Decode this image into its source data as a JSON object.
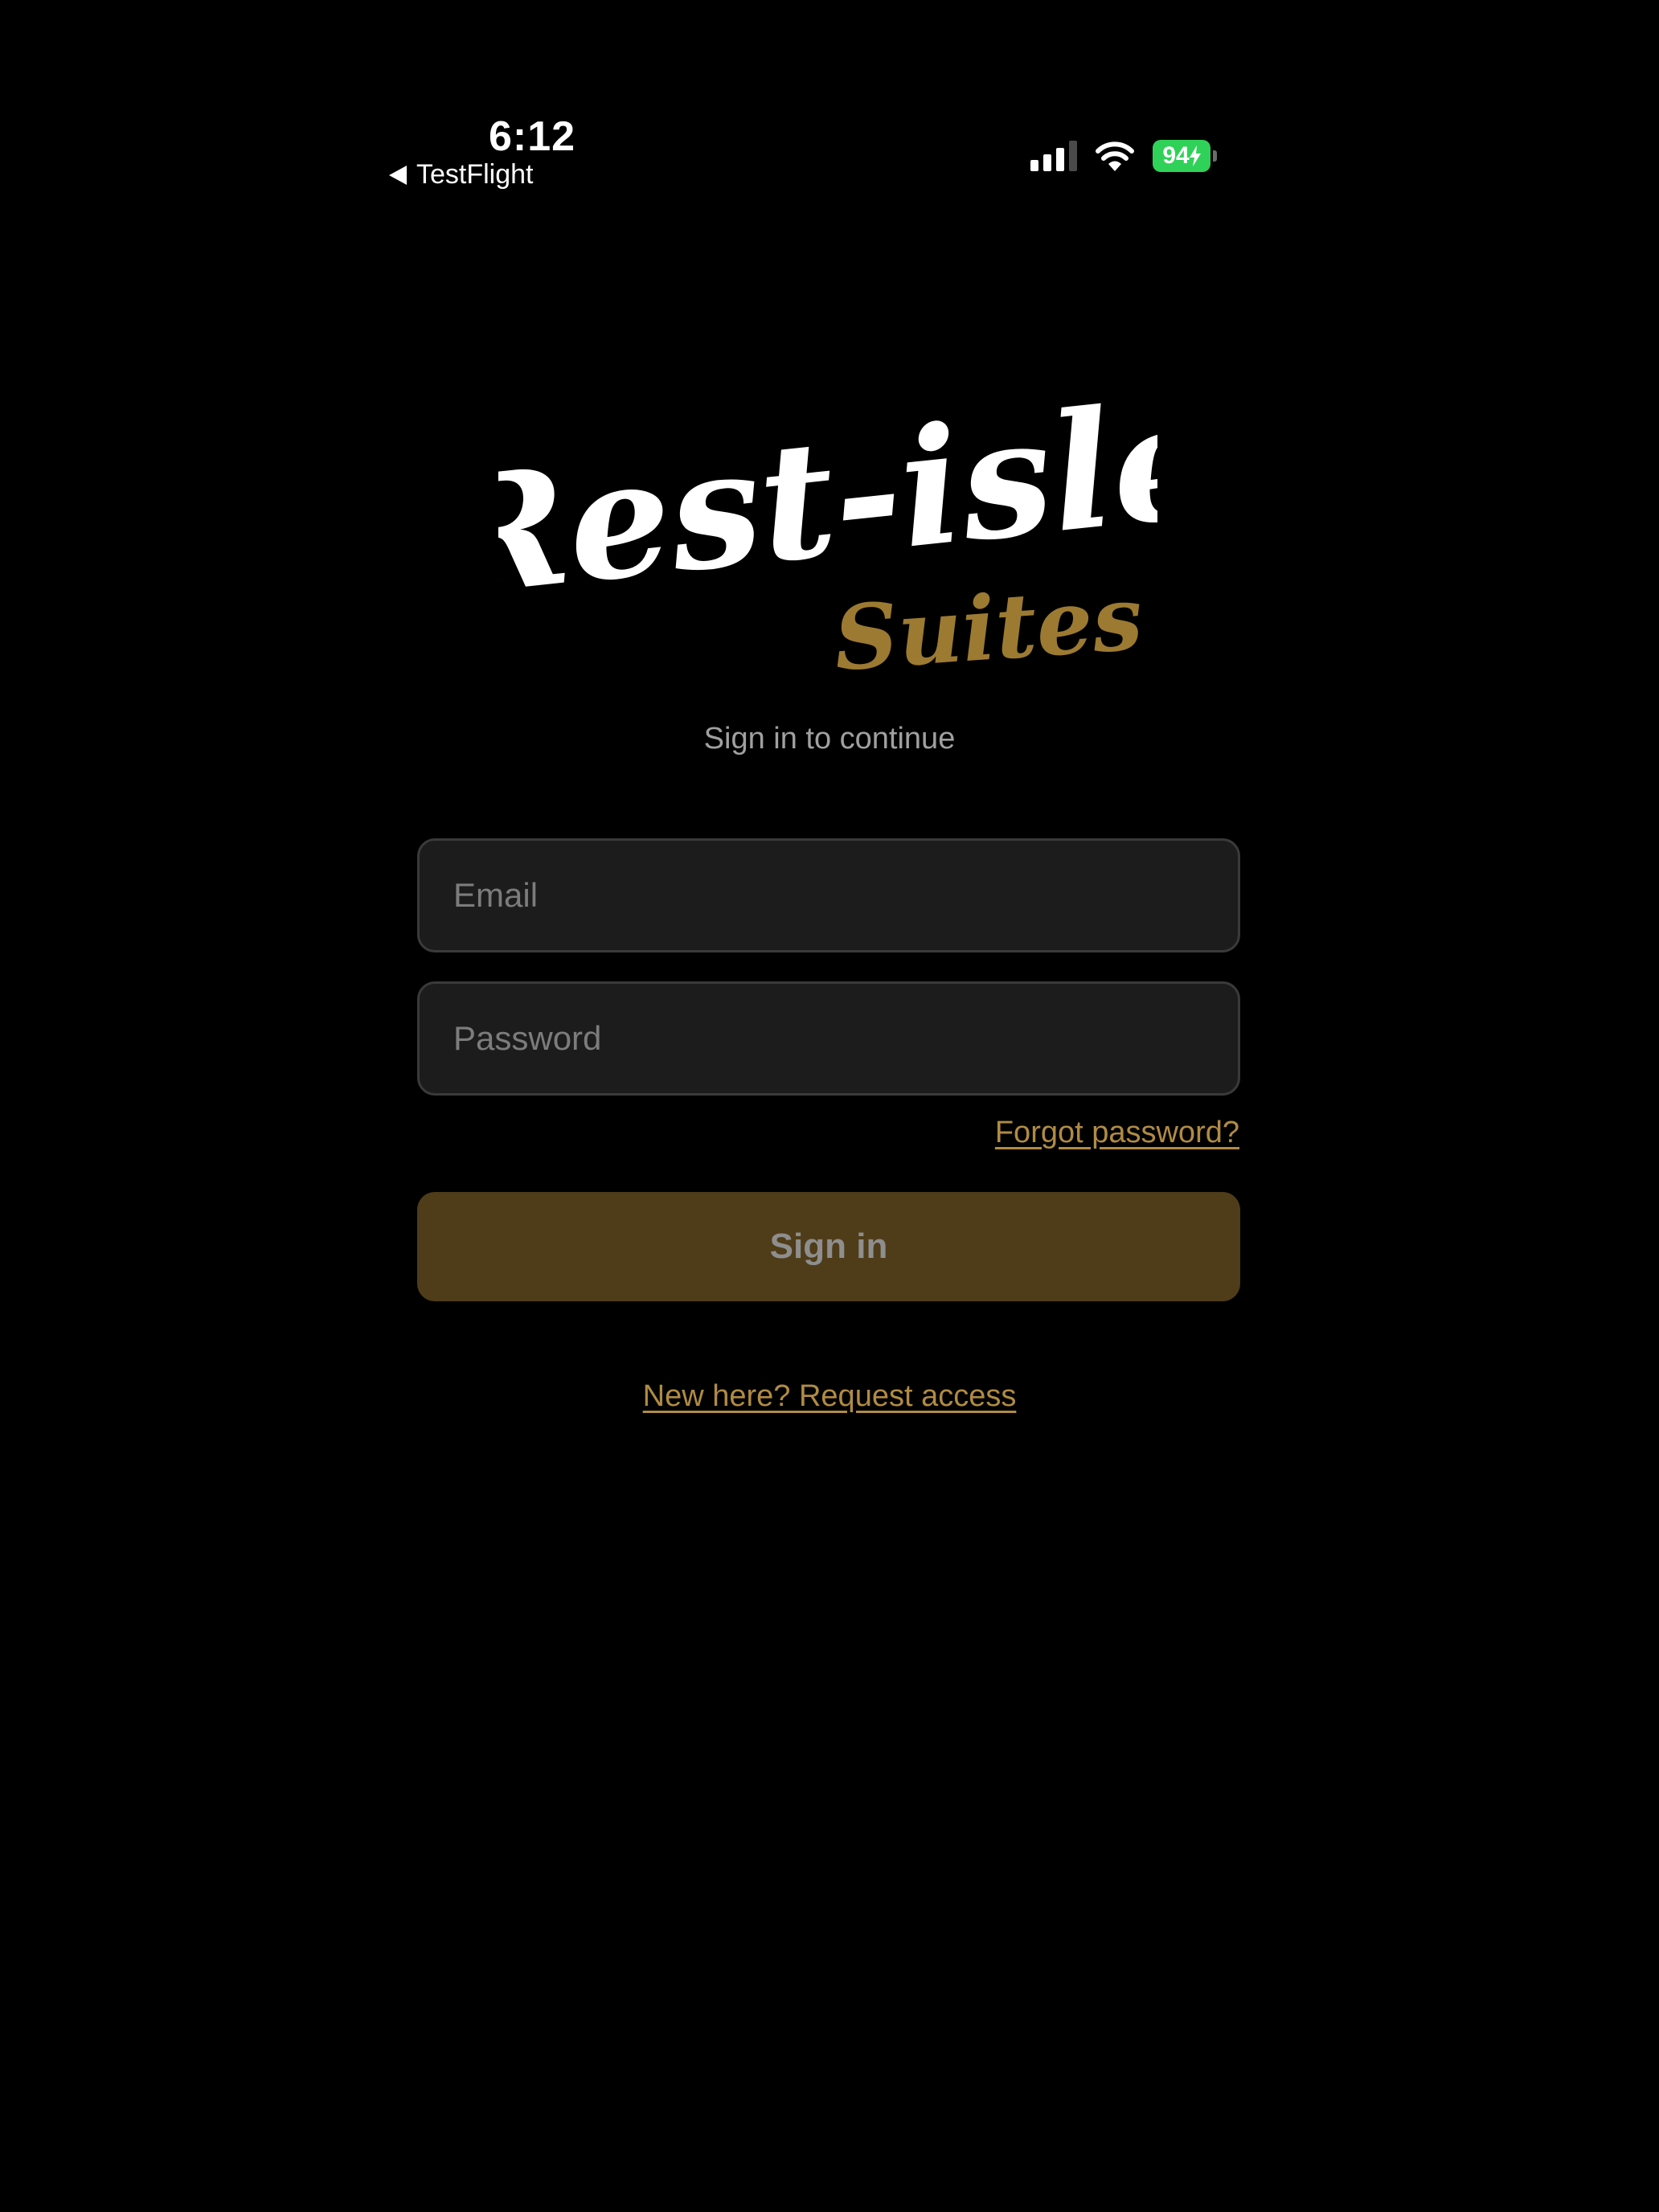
{
  "status_bar": {
    "time": "6:12",
    "back_label": "TestFlight",
    "battery_level": "94",
    "icons": [
      "back-arrow-icon",
      "cellular-signal-icon",
      "wifi-icon",
      "battery-icon",
      "charging-bolt-icon"
    ]
  },
  "logo": {
    "primary_text": "Rest-isle",
    "secondary_text": "Suites",
    "primary_color": "#ffffff",
    "secondary_color": "#9c7a32"
  },
  "login": {
    "subtitle": "Sign in to continue",
    "email_placeholder": "Email",
    "email_value": "",
    "password_placeholder": "Password",
    "password_value": "",
    "forgot_label": "Forgot password?",
    "signin_label": "Sign in",
    "request_access_label": "New here? Request access"
  },
  "colors": {
    "background": "#000000",
    "field_background": "#1c1c1c",
    "field_border": "#3a3a3a",
    "accent": "#b08b43",
    "button_background": "#4f3c19",
    "button_text": "#8e8e8e",
    "battery": "#30d158"
  }
}
